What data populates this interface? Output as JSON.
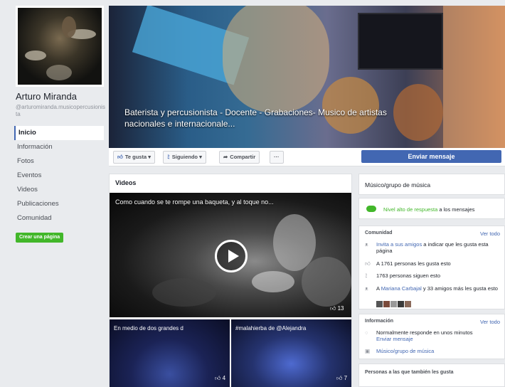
{
  "page": {
    "name": "Arturo Miranda",
    "handle": "@arturomiranda.musicopercusionista"
  },
  "nav": {
    "items": [
      {
        "label": "Inicio",
        "active": true
      },
      {
        "label": "Información"
      },
      {
        "label": "Fotos"
      },
      {
        "label": "Eventos"
      },
      {
        "label": "Videos"
      },
      {
        "label": "Publicaciones"
      },
      {
        "label": "Comunidad"
      }
    ],
    "create_page": "Crear una página"
  },
  "cover": {
    "text": "Baterista y percusionista - Docente - Grabaciones- Musico de artistas nacionales e internacionale..."
  },
  "actions": {
    "like": "Te gusta",
    "follow": "Siguiendo",
    "share": "Compartir",
    "more": "···",
    "send_message": "Enviar mensaje"
  },
  "videos": {
    "title": "Videos",
    "main": {
      "title": "Como cuando se te rompe una baqueta, y al toque no...",
      "likes": "13"
    },
    "thumbs": [
      {
        "title": "En medio de dos grandes d",
        "likes": "4"
      },
      {
        "title": "#malahierba de @Alejandra",
        "likes": "7"
      }
    ]
  },
  "sidebar": {
    "category": "Músico/grupo de música",
    "response": {
      "highlight": "Nivel alto de respuesta",
      "rest": " a los mensajes"
    },
    "community": {
      "title": "Comunidad",
      "see_all": "Ver todo",
      "invite_link": "Invita a sus amigos",
      "invite_rest": " a indicar que les gusta esta página",
      "likes": "A 1761 personas les gusta esto",
      "follows": "1763 personas siguen esto",
      "friend_prefix": "A ",
      "friend_name": "Mariana Carbajal",
      "friend_rest": " y 33 amigos más les gusta esto"
    },
    "info": {
      "title": "Información",
      "see_all": "Ver todo",
      "responds": "Normalmente responde en unos minutos",
      "send_message": "Enviar mensaje",
      "category_link": "Músico/grupo de música"
    },
    "people_also_like": "Personas a las que también les gusta"
  },
  "colors": {
    "accent": "#4267b2",
    "green": "#42b72a",
    "background": "#e9ebee"
  },
  "icons": [
    "thumbs-up-icon",
    "rss-icon",
    "share-arrow-icon",
    "play-icon",
    "people-icon",
    "chat-bubble-icon",
    "category-icon"
  ]
}
